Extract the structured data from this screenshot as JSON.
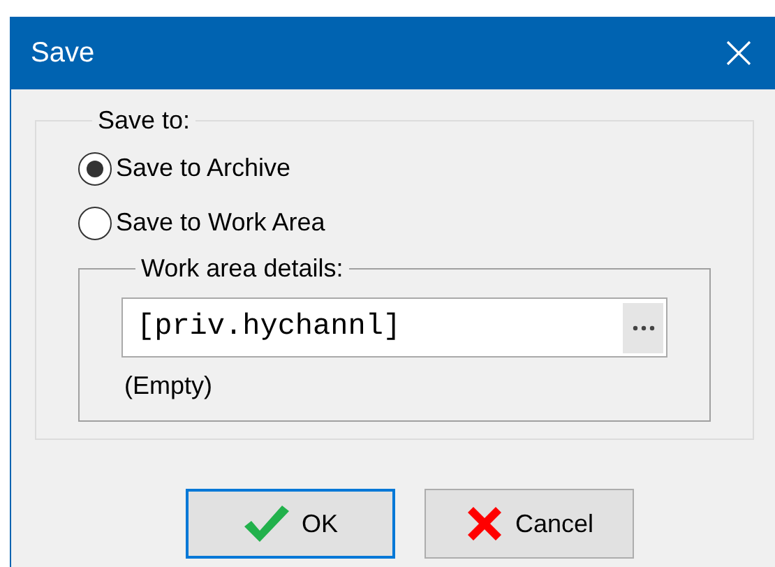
{
  "window": {
    "title": "Save"
  },
  "save_to": {
    "label": "Save to:",
    "options": [
      {
        "label": "Save to Archive",
        "selected": true
      },
      {
        "label": "Save to Work Area",
        "selected": false
      }
    ],
    "work_area_details": {
      "label": "Work area details:",
      "path": {
        "value": "[priv.hychannl]"
      },
      "status": "(Empty)"
    }
  },
  "buttons": [
    {
      "label": "OK",
      "kind": "ok",
      "focused": true
    },
    {
      "label": "Cancel",
      "kind": "cancel",
      "focused": false
    }
  ]
}
